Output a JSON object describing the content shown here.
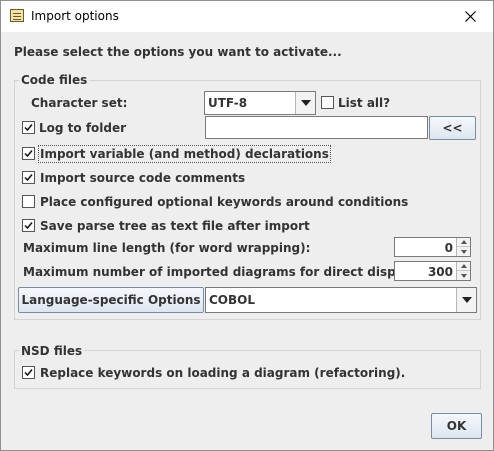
{
  "window": {
    "title": "Import options",
    "app_icon": "import-options-app-icon",
    "close_icon": "close-icon"
  },
  "heading": "Please select the options you want to activate...",
  "code_files": {
    "title": "Code files",
    "charset_label": "Character set:",
    "charset_value": "UTF-8",
    "list_all_label": "List all?",
    "list_all_checked": false,
    "log_to_folder_label": "Log to folder",
    "log_to_folder_checked": true,
    "log_folder_value": "",
    "browse_button_label": "<<",
    "options": [
      {
        "label": "Import variable (and method) declarations",
        "checked": true
      },
      {
        "label": "Import source code comments",
        "checked": true
      },
      {
        "label": "Place configured optional keywords around conditions",
        "checked": false
      },
      {
        "label": "Save parse tree as text file after import",
        "checked": true
      }
    ],
    "max_line_length_label": "Maximum line length (for word wrapping):",
    "max_line_length_value": "0",
    "max_diagrams_label": "Maximum number of imported diagrams for direct display:",
    "max_diagrams_value": "300",
    "language_button_label": "Language-specific Options",
    "language_value": "COBOL"
  },
  "nsd_files": {
    "title": "NSD files",
    "replace_keywords_label": "Replace keywords on loading a diagram (refactoring).",
    "replace_keywords_checked": true
  },
  "ok_label": "OK"
}
